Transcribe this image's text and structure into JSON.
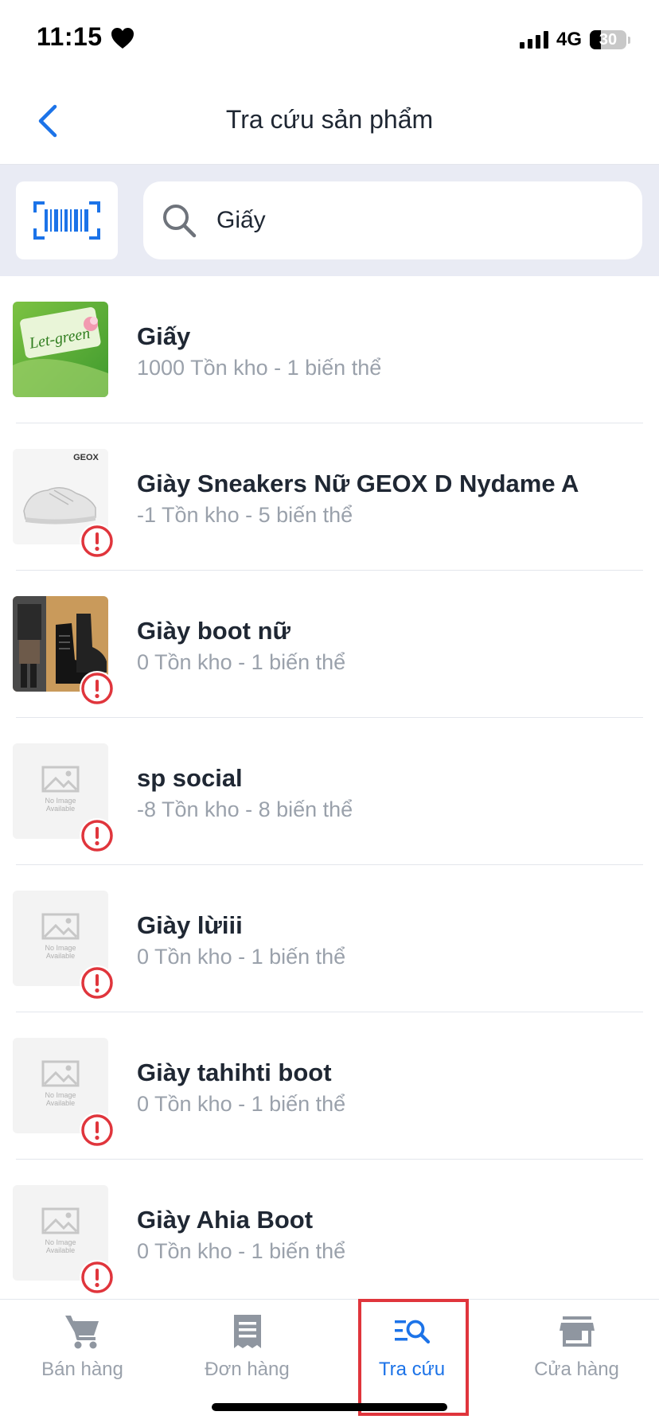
{
  "status_bar": {
    "time": "11:15",
    "network": "4G",
    "battery": "30",
    "battery_level": 0.3
  },
  "nav": {
    "title": "Tra cứu sản phẩm"
  },
  "search": {
    "value": "Giấy",
    "placeholder": ""
  },
  "products": [
    {
      "name": "Giấy",
      "meta": "1000 Tồn kho - 1 biến thể",
      "image": "let-green-photo",
      "warning": false
    },
    {
      "name": "Giày Sneakers Nữ GEOX D Nydame A",
      "meta": "-1 Tồn kho - 5 biến thể",
      "image": "geox-sneaker-photo",
      "warning": true
    },
    {
      "name": "Giày boot nữ",
      "meta": "0 Tồn kho - 1 biến thể",
      "image": "boot-photo",
      "warning": true
    },
    {
      "name": "sp social",
      "meta": "-8 Tồn kho - 8 biến thể",
      "image": "no-image",
      "warning": true
    },
    {
      "name": "Giày lừiii",
      "meta": "0 Tồn kho - 1 biến thể",
      "image": "no-image",
      "warning": true
    },
    {
      "name": "Giày tahihti boot",
      "meta": "0 Tồn kho - 1 biến thể",
      "image": "no-image",
      "warning": true
    },
    {
      "name": "Giày Ahia Boot",
      "meta": "0 Tồn kho - 1 biến thể",
      "image": "no-image",
      "warning": true
    }
  ],
  "placeholder_image": {
    "line1": "No Image",
    "line2": "Available"
  },
  "thumb_texts": {
    "let_green": "Let-green",
    "geox": "GEOX"
  },
  "tabs": [
    {
      "label": "Bán hàng",
      "icon": "cart-icon",
      "active": false
    },
    {
      "label": "Đơn hàng",
      "icon": "receipt-icon",
      "active": false
    },
    {
      "label": "Tra cứu",
      "icon": "lookup-search-icon",
      "active": true
    },
    {
      "label": "Cửa hàng",
      "icon": "store-icon",
      "active": false
    }
  ],
  "colors": {
    "accent": "#1c73e8",
    "warning": "#e0353c",
    "muted": "#9aa1ab",
    "search_bg": "#e9ebf4",
    "highlight_border": "#e0353c"
  }
}
